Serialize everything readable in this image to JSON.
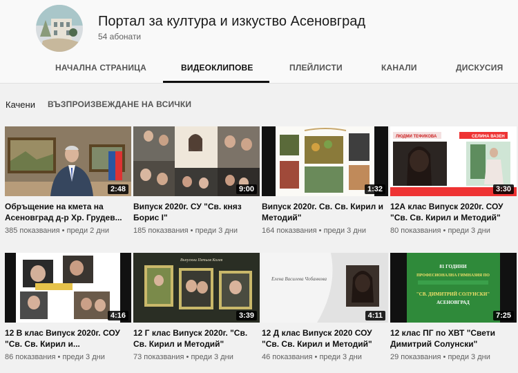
{
  "channel": {
    "title": "Портал за култура и изкуство Асеновград",
    "subscribers": "54 абонати"
  },
  "tabs": [
    {
      "label": "НАЧАЛНА СТРАНИЦА"
    },
    {
      "label": "ВИДЕОКЛИПОВЕ",
      "active": true
    },
    {
      "label": "ПЛЕЙЛИСТИ"
    },
    {
      "label": "КАНАЛИ"
    },
    {
      "label": "ДИСКУСИЯ"
    }
  ],
  "section": {
    "title": "Качени",
    "play_all": "ВЪЗПРОИЗВЕЖДАНЕ НА ВСИЧКИ"
  },
  "videos": [
    {
      "title": "Обръщение на кмета на Асеновград д-р Хр. Грудев...",
      "duration": "2:48",
      "views": "385 показвания",
      "age": "преди 2 дни"
    },
    {
      "title": "Випуск 2020г. СУ \"Св. княз Борис I\"",
      "duration": "9:00",
      "views": "185 показвания",
      "age": "преди 3 дни"
    },
    {
      "title": "Випуск 2020г. Св. Св. Кирил и Методий\"",
      "duration": "1:32",
      "views": "164 показвания",
      "age": "преди 3 дни"
    },
    {
      "title": "12А клас Випуск 2020г. СОУ \"Св. Св. Кирил и Методий\"",
      "duration": "3:30",
      "views": "80 показвания",
      "age": "преди 3 дни"
    },
    {
      "title": "12 В клас Випуск 2020г. СОУ \"Св. Св. Кирил и...",
      "duration": "4:16",
      "views": "86 показвания",
      "age": "преди 3 дни"
    },
    {
      "title": "12 Г клас Випуск 2020г. \"Св. Св. Кирил и Методий\"",
      "duration": "3:39",
      "views": "73 показвания",
      "age": "преди 3 дни"
    },
    {
      "title": "12 Д клас Випуск 2020 СОУ \"Св. Св. Кирил и Методий\"",
      "duration": "4:11",
      "views": "46 показвания",
      "age": "преди 3 дни"
    },
    {
      "title": "12 клас ПГ по ХВТ \"Свети Димитрий Солунски\"",
      "duration": "7:25",
      "views": "29 показвания",
      "age": "преди 3 дни"
    }
  ],
  "thumb_text": {
    "v6_banner": "Въпускни Петьов Колев",
    "v7_name": "Елена Василева Чобанкова",
    "v8_line1": "81 ГОДИНИ",
    "v8_line2": "ПРОФЕСИОНАЛНА ГИМНАЗИЯ ПО",
    "v8_line3": "\"СВ. ДИМИТРИЙ СОЛУНСКИ\"",
    "v8_line4": "АСЕНОВГРАД",
    "v4_tag1": "ЛЮДМИ ТЕФИКОВА",
    "v4_tag2": "СЕЛИНА ВАЗЕН"
  },
  "meta_separator": "•",
  "colors": {
    "accent": "#0f0f0f",
    "duration_bg": "#000000"
  }
}
